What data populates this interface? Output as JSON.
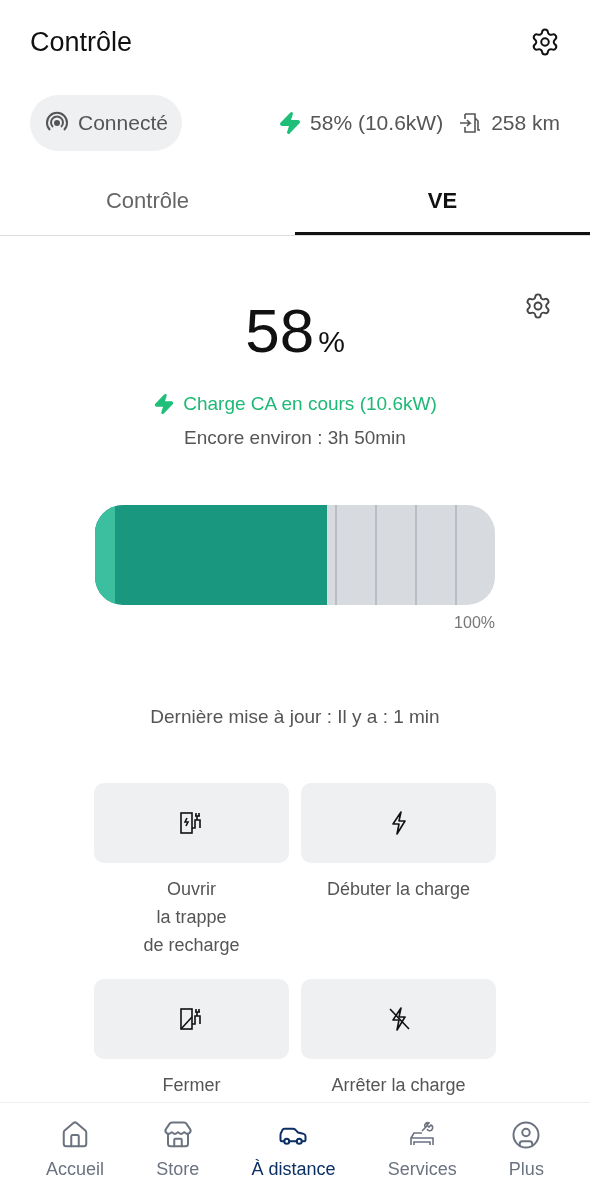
{
  "header": {
    "title": "Contrôle"
  },
  "status": {
    "connection": "Connecté",
    "charge": "58% (10.6kW)",
    "range": "258 km"
  },
  "tabs": [
    {
      "label": "Contrôle",
      "selected": false
    },
    {
      "label": "VE",
      "selected": true
    }
  ],
  "battery": {
    "percent": "58",
    "unit": "%",
    "charging_status": "Charge CA en cours (10.6kW)",
    "remaining": "Encore environ : 3h 50min",
    "level": 0.58,
    "max_label": "100%",
    "updated": "Dernière mise à jour : Il y a : 1 min"
  },
  "actions": [
    {
      "kind": "open-flap",
      "label": "Ouvrir\nla trappe\nde recharge"
    },
    {
      "kind": "start",
      "label": "Débuter la charge"
    },
    {
      "kind": "close-flap",
      "label": "Fermer"
    },
    {
      "kind": "stop",
      "label": "Arrêter la charge"
    }
  ],
  "nav": [
    {
      "kind": "home",
      "label": "Accueil",
      "selected": false
    },
    {
      "kind": "store",
      "label": "Store",
      "selected": false
    },
    {
      "kind": "car",
      "label": "À distance",
      "selected": true
    },
    {
      "kind": "services",
      "label": "Services",
      "selected": false
    },
    {
      "kind": "profile",
      "label": "Plus",
      "selected": false
    }
  ]
}
